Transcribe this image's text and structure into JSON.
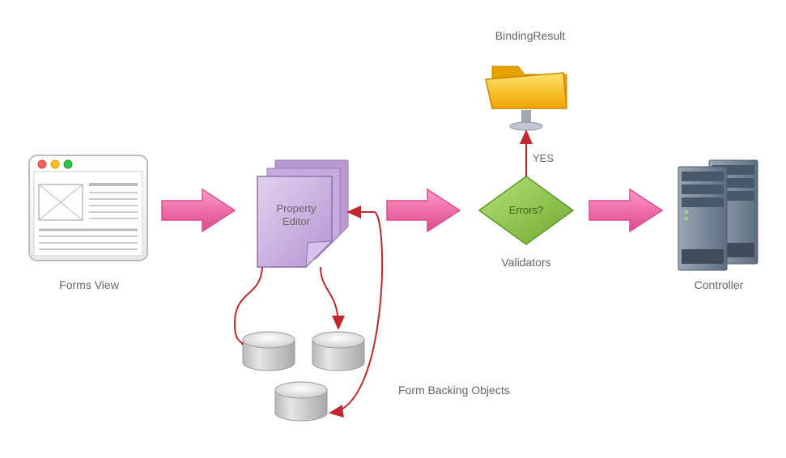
{
  "nodes": {
    "forms_view": {
      "label": "Forms View"
    },
    "property_editor": {
      "line1": "Property",
      "line2": "Editor"
    },
    "errors": {
      "label": "Errors?"
    },
    "validators": {
      "label": "Validators"
    },
    "yes": {
      "label": "YES"
    },
    "binding_result": {
      "label": "BindingResult"
    },
    "controller": {
      "label": "Controller"
    },
    "form_backing_objects": {
      "label": "Form Backing Objects"
    }
  },
  "colors": {
    "arrow_pink": "#f06eaa",
    "arrow_pink_dark": "#d84d8e",
    "red_line": "#c1272d",
    "diamond_green": "#8cc63f",
    "diamond_green_dark": "#6faa2e",
    "purple": "#c9aee0",
    "purple_dark": "#a289bf",
    "server_light": "#8a99a8",
    "server_dark": "#5e6e80",
    "cyl": "#d0d0d2",
    "cyl_top": "#ededed",
    "cyl_stroke": "#999",
    "folder_yellow": "#fbc02d",
    "folder_yellow_light": "#ffe082",
    "folder_yellow_dark": "#e6a200",
    "browser_body": "#f6f6f6",
    "browser_stroke": "#bdbdbd"
  }
}
